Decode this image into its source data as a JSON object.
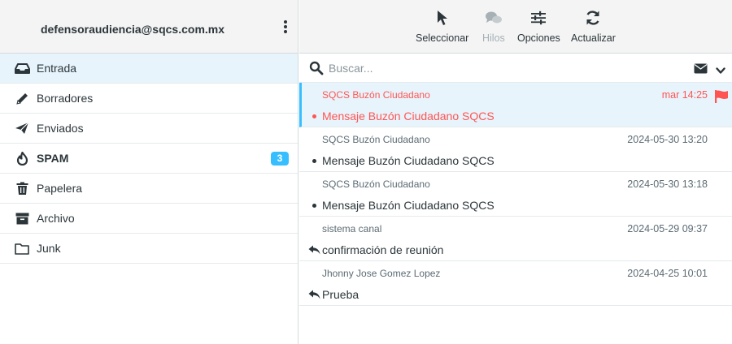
{
  "account": {
    "email": "defensoraudiencia@sqcs.com.mx"
  },
  "folders": [
    {
      "label": "Entrada",
      "icon": "inbox-icon",
      "selected": true
    },
    {
      "label": "Borradores",
      "icon": "pencil-icon"
    },
    {
      "label": "Enviados",
      "icon": "paper-plane-icon"
    },
    {
      "label": "SPAM",
      "icon": "fire-icon",
      "badge": "3"
    },
    {
      "label": "Papelera",
      "icon": "trash-icon"
    },
    {
      "label": "Archivo",
      "icon": "archive-icon"
    },
    {
      "label": "Junk",
      "icon": "folder-icon"
    }
  ],
  "toolbar": {
    "select_label": "Seleccionar",
    "threads_label": "Hilos",
    "options_label": "Opciones",
    "refresh_label": "Actualizar"
  },
  "search": {
    "placeholder": "Buscar..."
  },
  "messages": [
    {
      "from": "SQCS Buzón Ciudadano",
      "date": "mar 14:25",
      "subject": "Mensaje Buzón Ciudadano SQCS",
      "status": "unread",
      "flagged": true
    },
    {
      "from": "SQCS Buzón Ciudadano",
      "date": "2024-05-30 13:20",
      "subject": "Mensaje Buzón Ciudadano SQCS",
      "status": "unread"
    },
    {
      "from": "SQCS Buzón Ciudadano",
      "date": "2024-05-30 13:18",
      "subject": "Mensaje Buzón Ciudadano SQCS",
      "status": "unread"
    },
    {
      "from": "sistema canal",
      "date": "2024-05-29 09:37",
      "subject": "confirmación de reunión",
      "status": "replied"
    },
    {
      "from": "Jhonny Jose Gomez Lopez",
      "date": "2024-04-25 10:01",
      "subject": "Prueba",
      "status": "replied"
    }
  ],
  "colors": {
    "accent": "#37beff",
    "flag": "#ff5552",
    "selected_bg": "#e8f4fc",
    "header_bg": "#f4f4f4"
  }
}
